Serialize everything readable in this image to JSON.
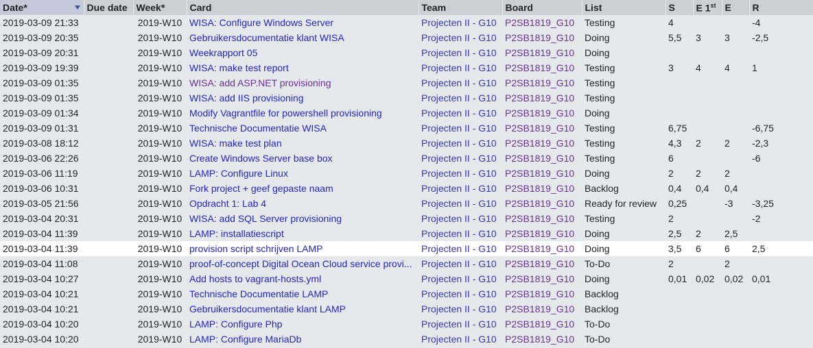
{
  "columns": {
    "date": "Date*",
    "due_date": "Due date",
    "week": "Week*",
    "card": "Card",
    "team": "Team",
    "board": "Board",
    "list": "List",
    "s": "S",
    "e1": "E 1",
    "e1_sup": "st",
    "e": "E",
    "r": "R"
  },
  "colors": {
    "card_link": "#2424c8",
    "card_visited": "#6a2e99",
    "team_link": "#3535b5",
    "board_link": "#6a2e99",
    "background": "#e6e9ec",
    "header": "#ccd0d4"
  },
  "sort_icon": "sort-desc-icon",
  "rows": [
    {
      "date": "2019-03-09 21:33",
      "due": "",
      "week": "2019-W10",
      "card": "WISA: Configure Windows Server",
      "team": "Projecten II - G10",
      "board": "P2SB1819_G10",
      "list": "Testing",
      "s": "4",
      "e1": "",
      "e": "",
      "r": "-4"
    },
    {
      "date": "2019-03-09 20:35",
      "due": "",
      "week": "2019-W10",
      "card": "Gebruikersdocumentatie klant WISA",
      "team": "Projecten II - G10",
      "board": "P2SB1819_G10",
      "list": "Doing",
      "s": "5,5",
      "e1": "3",
      "e": "3",
      "r": "-2,5"
    },
    {
      "date": "2019-03-09 20:31",
      "due": "",
      "week": "2019-W10",
      "card": "Weekrapport 05",
      "team": "Projecten II - G10",
      "board": "P2SB1819_G10",
      "list": "Doing",
      "s": "",
      "e1": "",
      "e": "",
      "r": ""
    },
    {
      "date": "2019-03-09 19:39",
      "due": "",
      "week": "2019-W10",
      "card": "WISA: make test report",
      "team": "Projecten II - G10",
      "board": "P2SB1819_G10",
      "list": "Testing",
      "s": "3",
      "e1": "4",
      "e": "4",
      "r": "1"
    },
    {
      "date": "2019-03-09 01:35",
      "due": "",
      "week": "2019-W10",
      "card": "WISA: add ASP.NET provisioning",
      "team": "Projecten II - G10",
      "board": "P2SB1819_G10",
      "list": "Testing",
      "s": "",
      "e1": "",
      "e": "",
      "r": "",
      "visited": true
    },
    {
      "date": "2019-03-09 01:35",
      "due": "",
      "week": "2019-W10",
      "card": "WISA: add IIS provisioning",
      "team": "Projecten II - G10",
      "board": "P2SB1819_G10",
      "list": "Testing",
      "s": "",
      "e1": "",
      "e": "",
      "r": ""
    },
    {
      "date": "2019-03-09 01:34",
      "due": "",
      "week": "2019-W10",
      "card": "Modify Vagrantfile for powershell provisioning",
      "team": "Projecten II - G10",
      "board": "P2SB1819_G10",
      "list": "Doing",
      "s": "",
      "e1": "",
      "e": "",
      "r": ""
    },
    {
      "date": "2019-03-09 01:31",
      "due": "",
      "week": "2019-W10",
      "card": "Technische Documentatie WISA",
      "team": "Projecten II - G10",
      "board": "P2SB1819_G10",
      "list": "Testing",
      "s": "6,75",
      "e1": "",
      "e": "",
      "r": "-6,75"
    },
    {
      "date": "2019-03-08 18:12",
      "due": "",
      "week": "2019-W10",
      "card": "WISA: make test plan",
      "team": "Projecten II - G10",
      "board": "P2SB1819_G10",
      "list": "Testing",
      "s": "4,3",
      "e1": "2",
      "e": "2",
      "r": "-2,3"
    },
    {
      "date": "2019-03-06 22:26",
      "due": "",
      "week": "2019-W10",
      "card": "Create Windows Server base box",
      "team": "Projecten II - G10",
      "board": "P2SB1819_G10",
      "list": "Testing",
      "s": "6",
      "e1": "",
      "e": "",
      "r": "-6"
    },
    {
      "date": "2019-03-06 11:19",
      "due": "",
      "week": "2019-W10",
      "card": "LAMP: Configure Linux",
      "team": "Projecten II - G10",
      "board": "P2SB1819_G10",
      "list": "Doing",
      "s": "2",
      "e1": "2",
      "e": "2",
      "r": ""
    },
    {
      "date": "2019-03-06 10:31",
      "due": "",
      "week": "2019-W10",
      "card": "Fork project + geef gepaste naam",
      "team": "Projecten II - G10",
      "board": "P2SB1819_G10",
      "list": "Backlog",
      "s": "0,4",
      "e1": "0,4",
      "e": "0,4",
      "r": ""
    },
    {
      "date": "2019-03-05 21:56",
      "due": "",
      "week": "2019-W10",
      "card": "Opdracht 1: Lab 4",
      "team": "Projecten II - G10",
      "board": "P2SB1819_G10",
      "list": "Ready for review",
      "s": "0,25",
      "e1": "",
      "e": "-3",
      "r": "-3,25"
    },
    {
      "date": "2019-03-04 20:31",
      "due": "",
      "week": "2019-W10",
      "card": "WISA: add SQL Server provisioning",
      "team": "Projecten II - G10",
      "board": "P2SB1819_G10",
      "list": "Testing",
      "s": "2",
      "e1": "",
      "e": "",
      "r": "-2"
    },
    {
      "date": "2019-03-04 11:39",
      "due": "",
      "week": "2019-W10",
      "card": "LAMP: installatiescript",
      "team": "Projecten II - G10",
      "board": "P2SB1819_G10",
      "list": "Doing",
      "s": "2,5",
      "e1": "2",
      "e": "2,5",
      "r": ""
    },
    {
      "date": "2019-03-04 11:39",
      "due": "",
      "week": "2019-W10",
      "card": "provision script schrijven LAMP",
      "team": "Projecten II - G10",
      "board": "P2SB1819_G10",
      "list": "Doing",
      "s": "3,5",
      "e1": "6",
      "e": "6",
      "r": "2,5",
      "highlight": true
    },
    {
      "date": "2019-03-04 11:08",
      "due": "",
      "week": "2019-W10",
      "card": "proof-of-concept Digital Ocean Cloud service provi...",
      "team": "Projecten II - G10",
      "board": "P2SB1819_G10",
      "list": "To-Do",
      "s": "2",
      "e1": "",
      "e": "2",
      "r": ""
    },
    {
      "date": "2019-03-04 10:27",
      "due": "",
      "week": "2019-W10",
      "card": "Add hosts to vagrant-hosts.yml",
      "team": "Projecten II - G10",
      "board": "P2SB1819_G10",
      "list": "Doing",
      "s": "0,01",
      "e1": "0,02",
      "e": "0,02",
      "r": "0,01"
    },
    {
      "date": "2019-03-04 10:21",
      "due": "",
      "week": "2019-W10",
      "card": "Technische Documentatie LAMP",
      "team": "Projecten II - G10",
      "board": "P2SB1819_G10",
      "list": "Backlog",
      "s": "",
      "e1": "",
      "e": "",
      "r": ""
    },
    {
      "date": "2019-03-04 10:21",
      "due": "",
      "week": "2019-W10",
      "card": "Gebruikersdocumentatie klant LAMP",
      "team": "Projecten II - G10",
      "board": "P2SB1819_G10",
      "list": "Backlog",
      "s": "",
      "e1": "",
      "e": "",
      "r": ""
    },
    {
      "date": "2019-03-04 10:20",
      "due": "",
      "week": "2019-W10",
      "card": "LAMP: Configure Php",
      "team": "Projecten II - G10",
      "board": "P2SB1819_G10",
      "list": "To-Do",
      "s": "",
      "e1": "",
      "e": "",
      "r": ""
    },
    {
      "date": "2019-03-04 10:20",
      "due": "",
      "week": "2019-W10",
      "card": "LAMP: Configure MariaDb",
      "team": "Projecten II - G10",
      "board": "P2SB1819_G10",
      "list": "To-Do",
      "s": "",
      "e1": "",
      "e": "",
      "r": ""
    }
  ]
}
